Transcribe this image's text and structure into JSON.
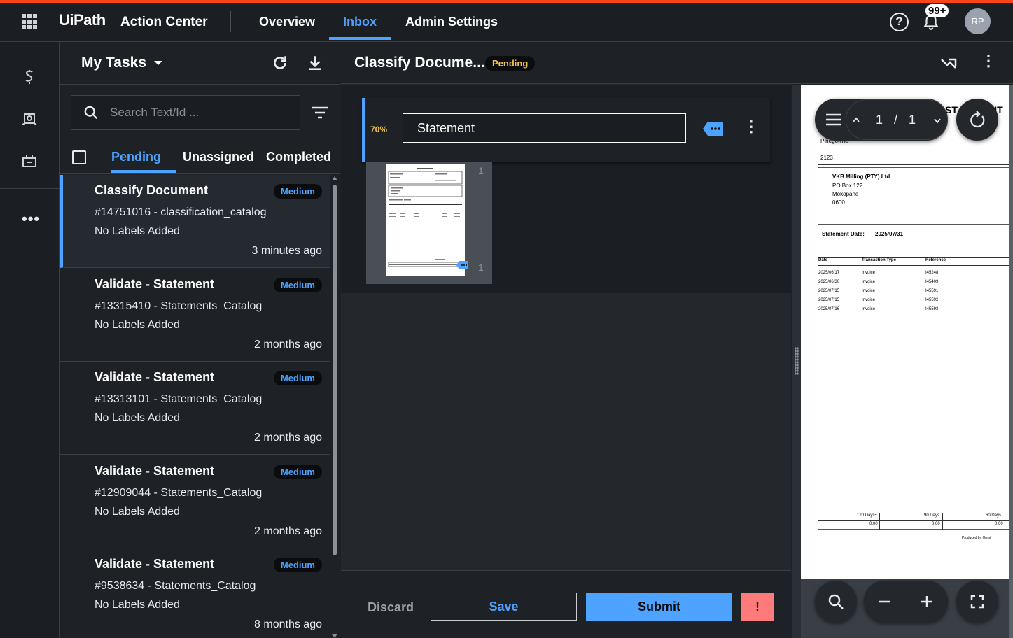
{
  "header": {
    "logo": "UiPath",
    "app_name": "Action Center",
    "nav": [
      "Overview",
      "Inbox",
      "Admin Settings"
    ],
    "active_nav": "Inbox",
    "notifications_badge": "99+",
    "avatar_initials": "RP"
  },
  "task_panel": {
    "title": "My Tasks",
    "search_placeholder": "Search Text/Id ...",
    "tabs": [
      "Pending",
      "Unassigned",
      "Completed"
    ],
    "active_tab": "Pending",
    "tasks": [
      {
        "title": "Classify Document",
        "priority": "Medium",
        "id": "#14751016 - classification_catalog",
        "labels": "No Labels Added",
        "time": "3 minutes ago"
      },
      {
        "title": "Validate - Statement",
        "priority": "Medium",
        "id": "#13315410 - Statements_Catalog",
        "labels": "No Labels Added",
        "time": "2 months ago"
      },
      {
        "title": "Validate - Statement",
        "priority": "Medium",
        "id": "#13313101 - Statements_Catalog",
        "labels": "No Labels Added",
        "time": "2 months ago"
      },
      {
        "title": "Validate - Statement",
        "priority": "Medium",
        "id": "#12909044 - Statements_Catalog",
        "labels": "No Labels Added",
        "time": "2 months ago"
      },
      {
        "title": "Validate - Statement",
        "priority": "Medium",
        "id": "#9538634 - Statements_Catalog",
        "labels": "No Labels Added",
        "time": "8 months ago"
      }
    ]
  },
  "main": {
    "title": "Classify Docume...",
    "status": "Pending",
    "classification": {
      "confidence": "70%",
      "value": "Statement"
    },
    "thumbnail": {
      "page_top": "1",
      "page_bottom": "1"
    },
    "footer": {
      "discard": "Discard",
      "save": "Save",
      "submit": "Submit",
      "exception": "!"
    }
  },
  "viewer": {
    "page_current": "1",
    "page_sep": "/",
    "page_total": "1",
    "doc": {
      "header_partial": "ST",
      "header_partial2": "NT",
      "from_partial": "Pinegowrie",
      "from_code": "2123",
      "to_name": "VKB Milling (PTY) Ltd",
      "to_line1": "PO Box 122",
      "to_line2": "Mokopane",
      "to_line3": "0600",
      "statement_date_label": "Statement Date:",
      "statement_date": "2025/07/31",
      "columns": [
        "Date",
        "Transaction Type",
        "Reference"
      ],
      "rows": [
        [
          "2025/06/17",
          "Invoice",
          "I45248"
        ],
        [
          "2025/06/30",
          "Invoice",
          "I45409"
        ],
        [
          "2025/07/15",
          "Invoice",
          "I45591"
        ],
        [
          "2025/07/15",
          "Invoice",
          "I45592"
        ],
        [
          "2025/07/16",
          "Invoice",
          "I45593"
        ]
      ],
      "aging_headers": [
        "120 Days+",
        "90 Days",
        "60 Days"
      ],
      "aging_values": [
        "0.00",
        "0.00",
        "0.00"
      ],
      "produced_by": "Produced by Omni"
    }
  }
}
